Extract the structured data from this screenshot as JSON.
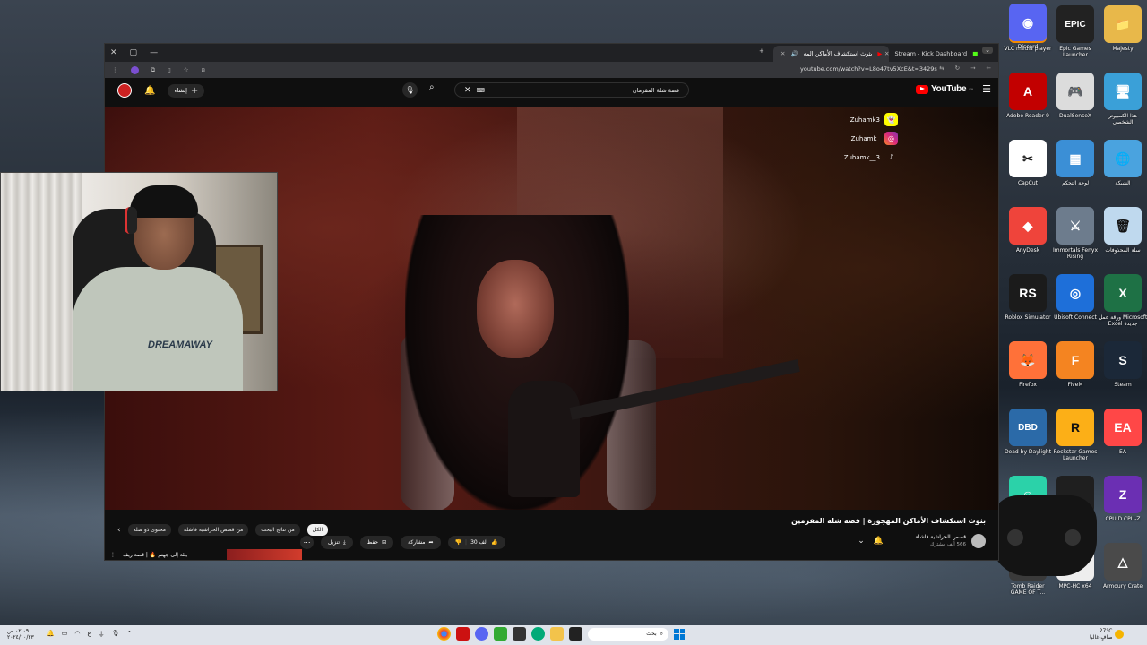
{
  "browser": {
    "tabs": [
      {
        "label": "Stream - Kick Dashboard"
      },
      {
        "label": "بثوث استكشاف الأماكن المه"
      }
    ],
    "url": "youtube.com/watch?v=L8o47tv5XcE&t=3429s"
  },
  "youtube": {
    "logo_text": "YouTube",
    "logo_sup": "SA",
    "search_query": "قصة شلة المقرمان",
    "create_label": "إنشاء",
    "video_title": "بثوث استكشاف الأماكن المهجورة | قصة شلة المقرمين",
    "channel_name": "قصص الحراشية فاشلة",
    "channel_subs": "566 ألف مشترك",
    "likes": "30 ألف",
    "share_label": "مشاركة",
    "save_label": "حفظ",
    "download_label": "تنزيل",
    "chips": [
      "الكل",
      "من نتائج البحث",
      "من قصص الحراشية فاشلة",
      "محتوى ذو صلة"
    ],
    "related_title": "بيئة إلى جهنم 🔥 | قصة ريف"
  },
  "socials": [
    {
      "icon": "snapchat-icon",
      "handle": "Zuhamk3"
    },
    {
      "icon": "instagram-icon",
      "handle": "Zuhamk_"
    },
    {
      "icon": "tiktok-icon",
      "handle": "Zuhamk__3"
    }
  ],
  "webcam": {
    "shirt_text": "DREAMAWAY"
  },
  "desktop_icons": [
    {
      "label": "VLC media player",
      "color": "#f28a00",
      "glyph": "▲"
    },
    {
      "label": "Epic Games Launcher",
      "color": "#222222",
      "glyph": "EPIC"
    },
    {
      "label": "Majesty",
      "color": "#e8b84a",
      "glyph": "📁"
    },
    {
      "label": "Adobe Reader 9",
      "color": "#c20000",
      "glyph": "A"
    },
    {
      "label": "DualSenseX",
      "color": "#dcdcdc",
      "glyph": "🎮"
    },
    {
      "label": "هذا الكمبيوتر الشخصي",
      "color": "#3aa0d8",
      "glyph": "🖥"
    },
    {
      "label": "CapCut",
      "color": "#ffffff",
      "glyph": "✂"
    },
    {
      "label": "لوحة التحكم",
      "color": "#3b8fd6",
      "glyph": "▦"
    },
    {
      "label": "الشبكة",
      "color": "#4aa3df",
      "glyph": "🌐"
    },
    {
      "label": "AnyDesk",
      "color": "#ef443b",
      "glyph": "◆"
    },
    {
      "label": "Immortals Fenyx Rising",
      "color": "#6d7c8d",
      "glyph": "⚔"
    },
    {
      "label": "سلة المحذوفات",
      "color": "#bfd9ee",
      "glyph": "🗑"
    },
    {
      "label": "Roblox Simulator",
      "color": "#1b1b1b",
      "glyph": "RS"
    },
    {
      "label": "Ubisoft Connect",
      "color": "#1e6fd9",
      "glyph": "◎"
    },
    {
      "label": "ورقة عمل Microsoft Excel جديدة",
      "color": "#1e7145",
      "glyph": "X"
    },
    {
      "label": "Firefox",
      "color": "#ff7139",
      "glyph": "🦊"
    },
    {
      "label": "FiveM",
      "color": "#f48421",
      "glyph": "F"
    },
    {
      "label": "Steam",
      "color": "#1b2838",
      "glyph": "S"
    },
    {
      "label": "Dead by Daylight",
      "color": "#2b6aa8",
      "glyph": "DBD"
    },
    {
      "label": "Rockstar Games Launcher",
      "color": "#fcaf17",
      "glyph": "R"
    },
    {
      "label": "EA",
      "color": "#ff4747",
      "glyph": "EA"
    },
    {
      "label": "",
      "color": "#2bd2a9",
      "glyph": "☺"
    },
    {
      "label": "",
      "color": "#1f1f1f",
      "glyph": ""
    },
    {
      "label": "CPUID CPU-Z",
      "color": "#6b2fb3",
      "glyph": "Z"
    },
    {
      "label": "Tomb Raider GAME OF T...",
      "color": "#3a3a3a",
      "glyph": "TR"
    },
    {
      "label": "MPC-HC x64",
      "color": "#eeeeee",
      "glyph": "321"
    },
    {
      "label": "Armoury Crate",
      "color": "#4a4a4a",
      "glyph": "△"
    },
    {
      "label": "Discord",
      "color": "#5865f2",
      "glyph": "◉"
    }
  ],
  "taskbar": {
    "time": "٠٢:٠٩ ص",
    "date": "٢٠٢٤/١٠/٢٣",
    "weather_temp": "27°C",
    "weather_desc": "صافٍ غالبا",
    "search_placeholder": "بحث",
    "lang": "ع"
  }
}
